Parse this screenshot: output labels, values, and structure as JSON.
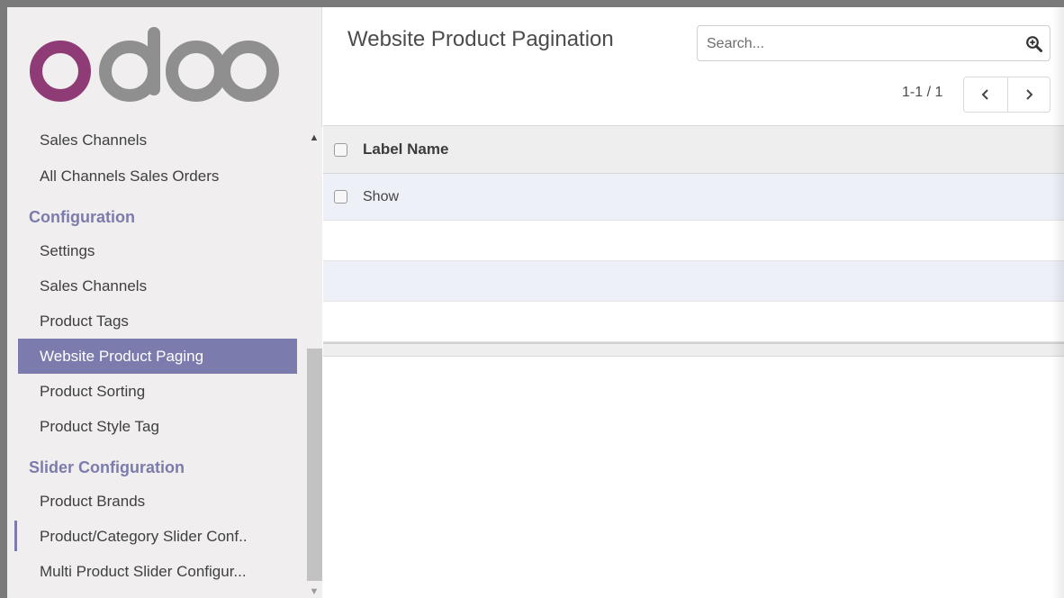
{
  "brand": {
    "logo_text": "odoo",
    "colors": {
      "logo_o": "#8f3b76",
      "logo_rest": "#8f8f8f",
      "accent": "#7c7bad"
    }
  },
  "sidebar": {
    "items": [
      {
        "type": "item",
        "label": "Sales Channels"
      },
      {
        "type": "item",
        "label": "All Channels Sales Orders"
      },
      {
        "type": "section",
        "label": "Configuration"
      },
      {
        "type": "item",
        "label": "Settings"
      },
      {
        "type": "item",
        "label": "Sales Channels"
      },
      {
        "type": "item",
        "label": "Product Tags"
      },
      {
        "type": "item",
        "label": "Website Product Paging",
        "active": true
      },
      {
        "type": "item",
        "label": "Product Sorting"
      },
      {
        "type": "item",
        "label": "Product Style Tag"
      },
      {
        "type": "section",
        "label": "Slider Configuration"
      },
      {
        "type": "item",
        "label": "Product Brands"
      },
      {
        "type": "item",
        "label": "Product/Category Slider Conf.."
      },
      {
        "type": "item",
        "label": "Multi Product Slider Configur..."
      }
    ]
  },
  "control_panel": {
    "title": "Website Product Pagination",
    "search": {
      "placeholder": "Search...",
      "value": "",
      "icon": "zoom-in-icon"
    },
    "pager": {
      "value": "1-1 / 1",
      "prev_icon": "chevron-left-icon",
      "next_icon": "chevron-right-icon"
    }
  },
  "list": {
    "columns": [
      "Label Name"
    ],
    "rows": [
      {
        "label_name": "Show"
      }
    ]
  }
}
